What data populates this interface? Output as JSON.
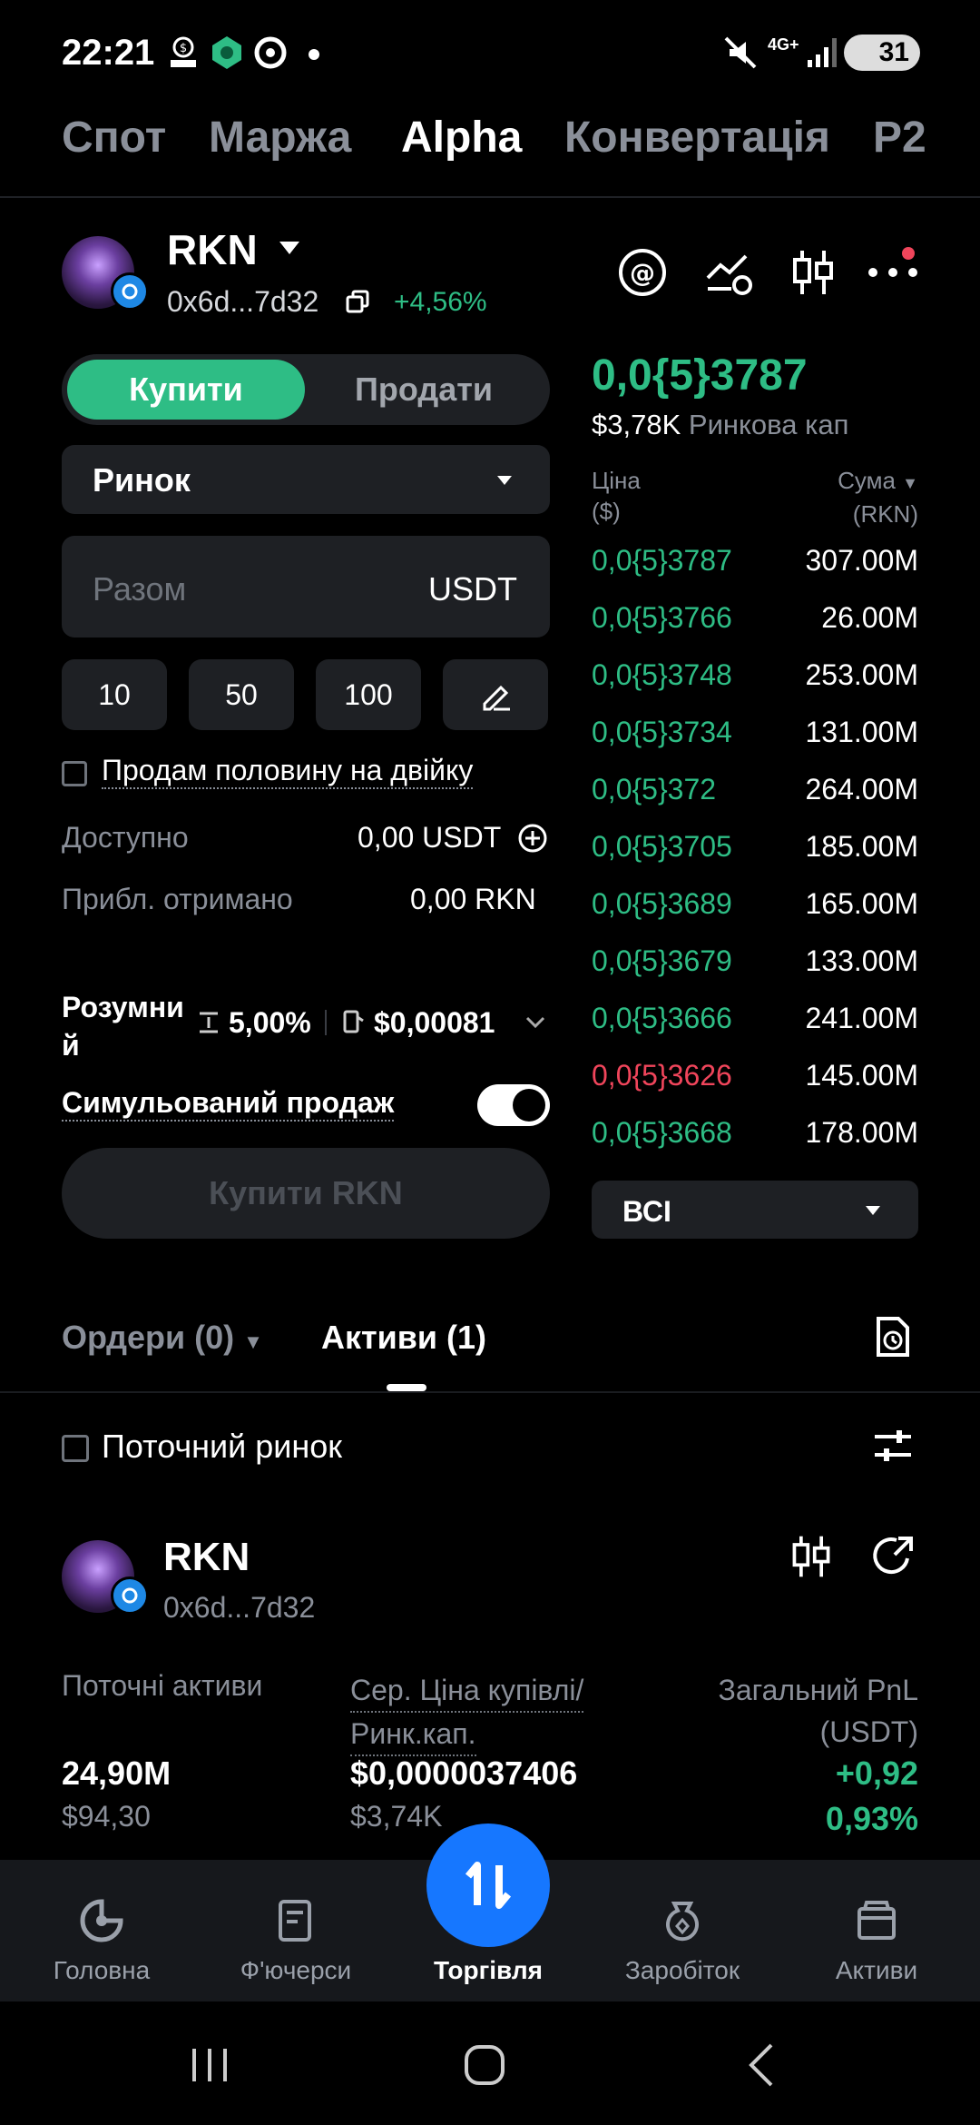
{
  "status_bar": {
    "time": "22:21",
    "battery": "31",
    "network": "4G+"
  },
  "top_tabs": [
    "Спот",
    "Маржа",
    "Alpha",
    "Конвертація",
    "P2"
  ],
  "token": {
    "symbol": "RKN",
    "address": "0x6d...7d32",
    "change": "+4,56%"
  },
  "trade": {
    "buy_label": "Купити",
    "sell_label": "Продати",
    "order_type": "Ринок",
    "amount_placeholder": "Разом",
    "amount_unit": "USDT",
    "presets": [
      "10",
      "50",
      "100"
    ],
    "double_sell_label": "Продам половину на двійку",
    "available_label": "Доступно",
    "available_value": "0,00 USDT",
    "receive_label": "Прибл. отримано",
    "receive_value": "0,00 RKN",
    "smart_label": "Розумний",
    "slippage": "5,00%",
    "gas": "$0,00081",
    "simulated_label": "Симульований продаж",
    "simulated_on": true,
    "submit_label": "Купити RKN"
  },
  "orderbook": {
    "price": "0,0{5}3787",
    "mcap_value": "$3,78K",
    "mcap_label": "Ринкова кап",
    "col_price": "Ціна",
    "col_price_unit": "($)",
    "col_amount": "Сума",
    "col_amount_unit": "(RKN)",
    "rows": [
      {
        "price": "0,0{5}3787",
        "amount": "307.00M",
        "side": "buy"
      },
      {
        "price": "0,0{5}3766",
        "amount": "26.00M",
        "side": "buy"
      },
      {
        "price": "0,0{5}3748",
        "amount": "253.00M",
        "side": "buy"
      },
      {
        "price": "0,0{5}3734",
        "amount": "131.00M",
        "side": "buy"
      },
      {
        "price": "0,0{5}372",
        "amount": "264.00M",
        "side": "buy"
      },
      {
        "price": "0,0{5}3705",
        "amount": "185.00M",
        "side": "buy"
      },
      {
        "price": "0,0{5}3689",
        "amount": "165.00M",
        "side": "buy"
      },
      {
        "price": "0,0{5}3679",
        "amount": "133.00M",
        "side": "buy"
      },
      {
        "price": "0,0{5}3666",
        "amount": "241.00M",
        "side": "buy"
      },
      {
        "price": "0,0{5}3626",
        "amount": "145.00M",
        "side": "sell"
      },
      {
        "price": "0,0{5}3668",
        "amount": "178.00M",
        "side": "buy"
      }
    ],
    "filter": "ВСІ"
  },
  "orders_tabs": {
    "orders": "Ордери (0)",
    "assets": "Активи (1)"
  },
  "current_market_label": "Поточний ринок",
  "asset": {
    "symbol": "RKN",
    "address": "0x6d...7d32",
    "holdings_label": "Поточні активи",
    "holdings_value": "24,90M",
    "holdings_usd": "$94,30",
    "avg_label_1": "Сер. Ціна купівлі/",
    "avg_label_2": "Ринк.кап.",
    "avg_value": "$0,0000037406",
    "avg_mcap": "$3,74K",
    "pnl_label_1": "Загальний PnL",
    "pnl_label_2": "(USDT)",
    "pnl_value": "+0,92",
    "pnl_pct": "0,93%"
  },
  "tabbar": [
    "Головна",
    "Ф'ючерси",
    "Торгівля",
    "Заробіток",
    "Активи"
  ],
  "colors": {
    "green": "#2ebd85",
    "red": "#f0455b",
    "accent_blue": "#1677ff"
  }
}
